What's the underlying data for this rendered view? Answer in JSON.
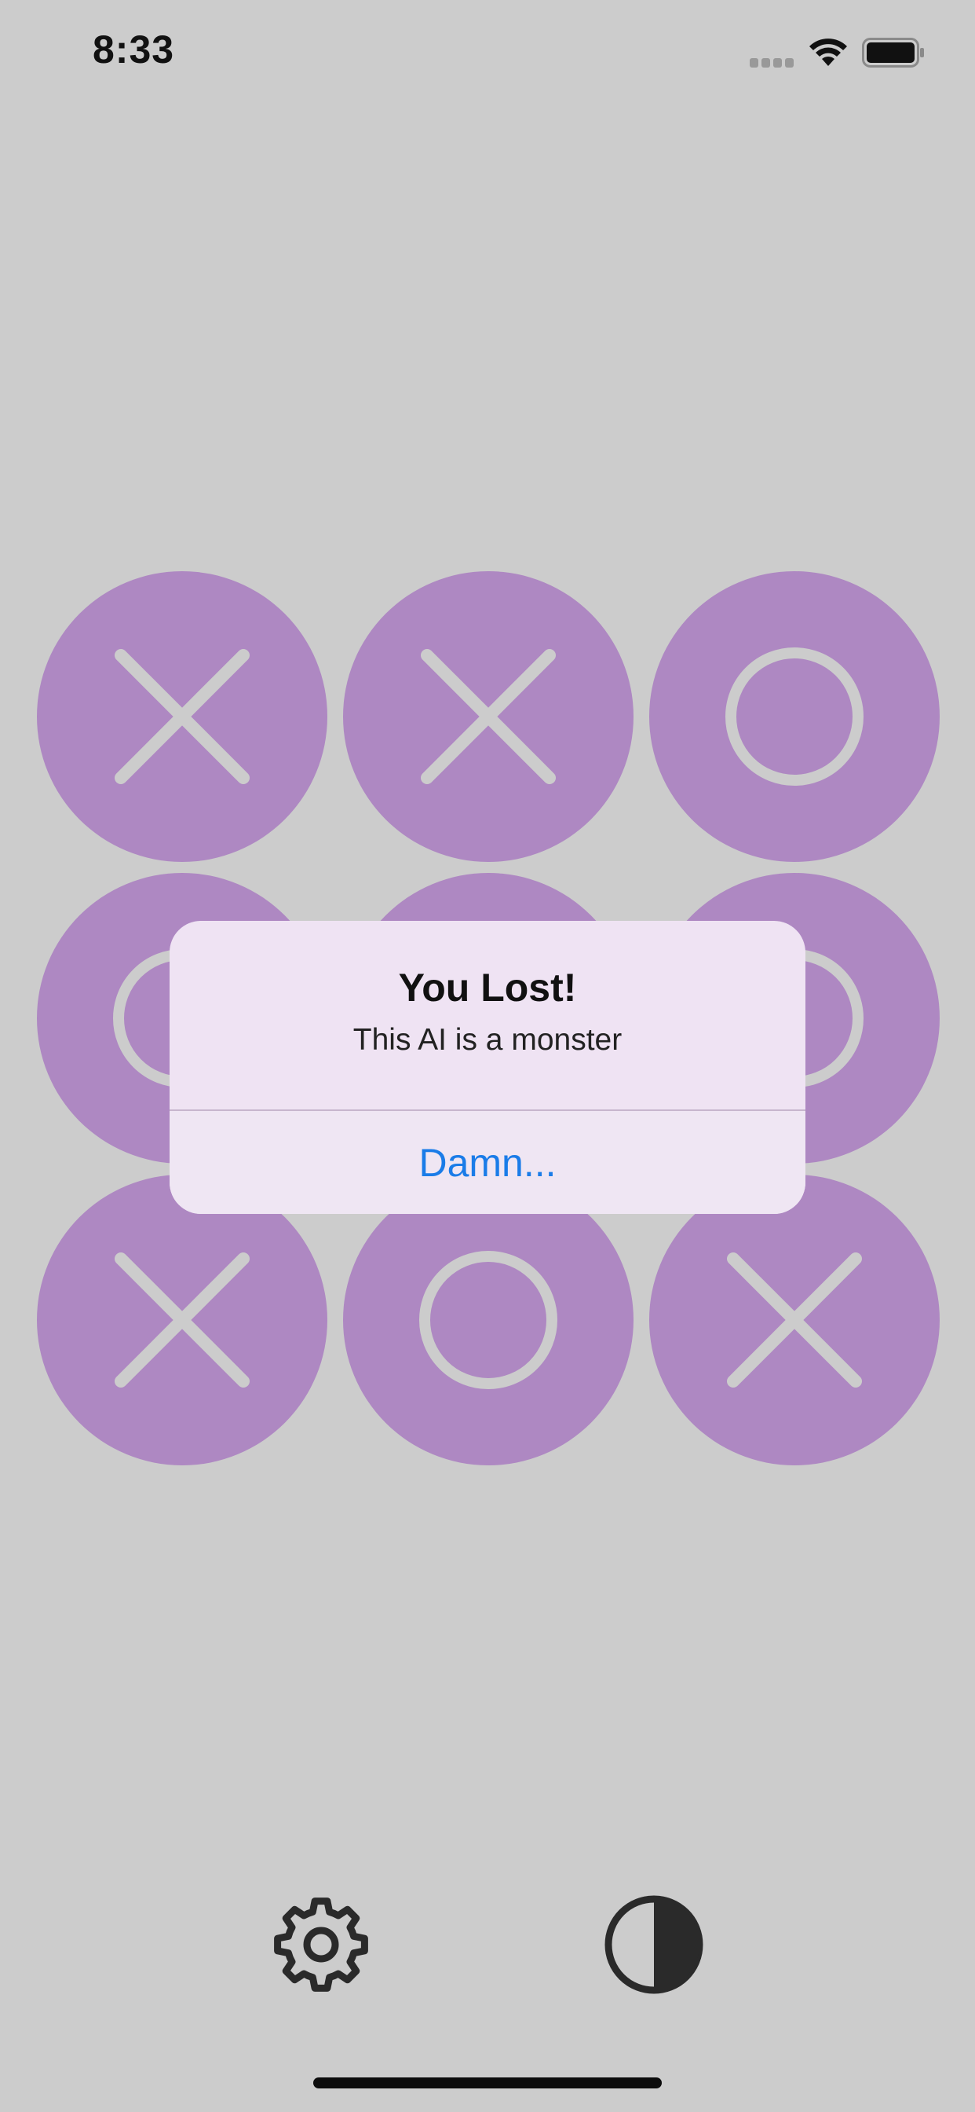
{
  "status_bar": {
    "time": "8:33",
    "icons": [
      "cellular-signal-icon",
      "wifi-icon",
      "battery-icon"
    ]
  },
  "board": {
    "cells": [
      "X",
      "X",
      "O",
      "O",
      "",
      "O",
      "X",
      "O",
      "X"
    ],
    "cell_color": "#ae88c2",
    "mark_color": "#cccccc"
  },
  "alert": {
    "title": "You Lost!",
    "message": "This AI is a monster",
    "button_label": "Damn..."
  },
  "toolbar": {
    "settings_icon": "gear-icon",
    "theme_icon": "contrast-icon"
  },
  "colors": {
    "background": "#cccccc",
    "accent": "#1a7ce8"
  }
}
